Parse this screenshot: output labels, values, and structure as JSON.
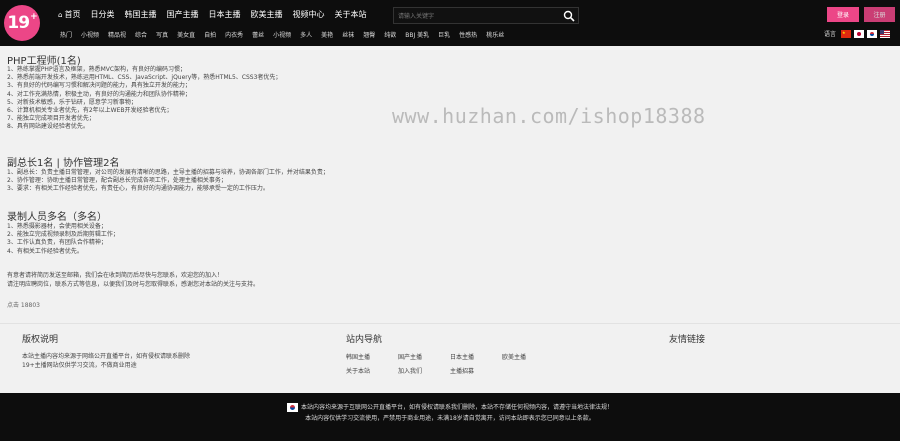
{
  "header": {
    "logo_text": "19",
    "logo_plus": "+",
    "nav": [
      "首页",
      "日分类",
      "韩国主播",
      "国产主播",
      "日本主播",
      "欧美主播",
      "视频中心",
      "关于本站"
    ],
    "search_placeholder": "请输入关键字",
    "login_label": "登录",
    "register_label": "注册",
    "subnav": [
      "热门",
      "小视频",
      "精品视",
      "综合",
      "写真",
      "美女直",
      "自拍",
      "内衣秀",
      "蕾丝",
      "小视频",
      "多人",
      "美艳",
      "丝袜",
      "翘臀",
      "纯欲",
      "BBJ 美乳",
      "巨乳",
      "性感热",
      "桃乐丝"
    ],
    "language_label": "语言",
    "flags": [
      "cn-flag",
      "jp-flag",
      "kr-flag",
      "us-flag"
    ],
    "accent_color": "#ec4687"
  },
  "main": {
    "section1": {
      "title": "PHP工程师(1名)",
      "items": [
        "1、熟练掌握PHP语言及框架，熟悉MVC架构，有良好的编码习惯；",
        "2、熟悉前端开发技术，熟练运用HTML、CSS、JavaScript、jQuery等，熟悉HTML5、CSS3者优先；",
        "3、有良好的代码编写习惯和解决问题的能力，具有独立开发的能力；",
        "4、对工作充满热情，积极主动，有良好的沟通能力和团队协作精神；",
        "5、对新技术敏感，乐于钻研，愿意学习新事物；",
        "6、计算机相关专业者优先，有2年以上WEB开发经验者优先；",
        "7、能独立完成项目开发者优先；",
        "8、具有网站建设经验者优先。"
      ]
    },
    "section2": {
      "title": "副总长1名 | 协作管理2名",
      "items": [
        "1、副总长：负责主播日常管理，对公司的发展有清晰的思路，主导主播的招募与培养，协调各部门工作，并对结果负责；",
        "2、协作管理：协助主播日常管理，配合副总长完成各项工作，处理主播相关事务；",
        "3、要求：有相关工作经验者优先，有责任心，有良好的沟通协调能力，能够承受一定的工作压力。"
      ]
    },
    "section3": {
      "title": "录制人员多名（多名）",
      "items": [
        "1、熟悉摄影器材，会使用相关设备；",
        "2、能独立完成视频录制及后期剪辑工作；",
        "3、工作认真负责，有团队合作精神；",
        "4、有相关工作经验者优先。"
      ]
    },
    "contact": [
      "有意者请将简历发送至邮箱，我们会在收到简历后尽快与您联系，欢迎您的加入！",
      "请注明应聘岗位，联系方式等信息，以便我们及时与您取得联系，感谢您对本站的关注与支持。"
    ],
    "page_views": "点击 18803"
  },
  "watermark": "www.huzhan.com/ishop18388",
  "footer": {
    "about_title": "版权说明",
    "about_lines": [
      "本站主播内容均来源于网络公开直播平台，如有侵权请联系删除",
      "19+主播网站仅供学习交流，不做商业用途"
    ],
    "nav_title": "站内导航",
    "nav_links": [
      "韩国主播",
      "国产主播",
      "日本主播",
      "欧美主播",
      "关于本站",
      "加入我们",
      "主播招募"
    ],
    "friends_title": "友情链接",
    "disclaimer_lines": [
      "本站内容均来源于互联网公开直播平台，如有侵权请联系我们删除，本站不存储任何视频内容，请遵守当地法律法规！",
      "本站内容仅供学习交流使用，严禁用于商业用途，未满18岁请自觉离开，访问本站即表示您已同意以上条款。"
    ]
  }
}
